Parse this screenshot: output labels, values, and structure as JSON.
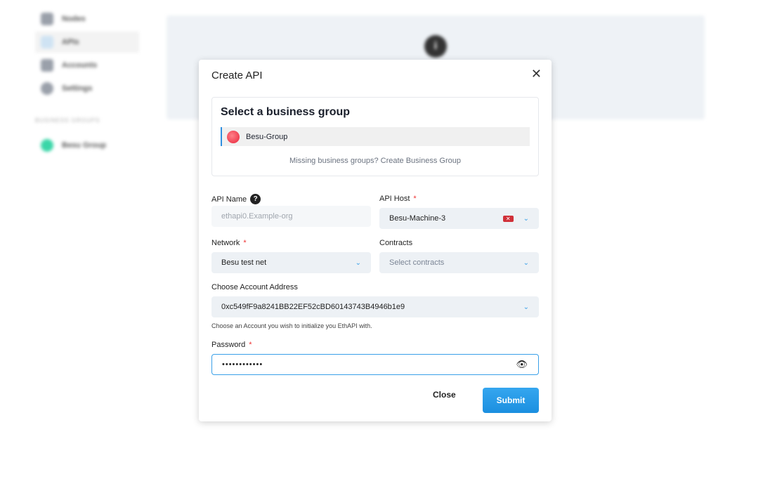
{
  "sidebar": {
    "items": [
      {
        "label": "Nodes"
      },
      {
        "label": "APIs"
      },
      {
        "label": "Accounts"
      },
      {
        "label": "Settings"
      }
    ],
    "group_heading": "BUSINESS GROUPS",
    "groups": [
      {
        "label": "Besu Group"
      }
    ]
  },
  "modal": {
    "title": "Create API",
    "business_group": {
      "heading": "Select a business group",
      "selected": "Besu-Group",
      "missing_text": "Missing business groups? Create Business Group"
    },
    "api_name": {
      "label": "API Name",
      "placeholder": "ethapi0.Example-org"
    },
    "api_host": {
      "label": "API Host",
      "value": "Besu-Machine-3"
    },
    "network": {
      "label": "Network",
      "value": "Besu test net"
    },
    "contracts": {
      "label": "Contracts",
      "placeholder": "Select contracts"
    },
    "account": {
      "label": "Choose Account Address",
      "value": "0xc549fF9a8241BB22EF52cBD60143743B4946b1e9",
      "hint": "Choose an Account you wish to initialize you EthAPI with."
    },
    "password": {
      "label": "Password",
      "value": "••••••••••••"
    },
    "close_label": "Close",
    "submit_label": "Submit",
    "required_mark": "*"
  },
  "colors": {
    "accent": "#1b8fe0",
    "required": "#e33333"
  }
}
